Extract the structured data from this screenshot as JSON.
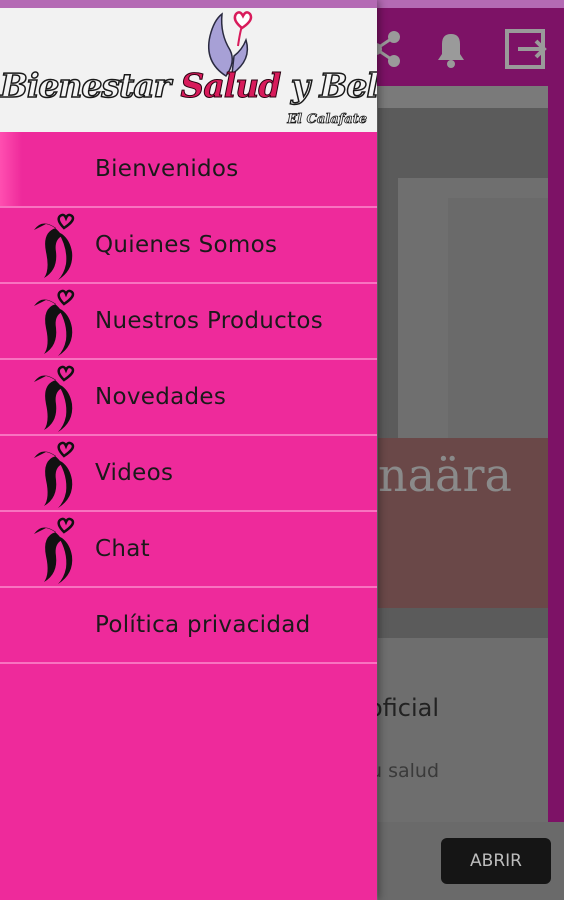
{
  "app": {
    "actions": [
      {
        "icon": "share-icon"
      },
      {
        "icon": "bell-icon"
      },
      {
        "icon": "logout-icon"
      }
    ],
    "card": {
      "brand_text": "naära",
      "title": "oficial",
      "subtitle": "u salud"
    },
    "footer": {
      "button_label": "ABRIR"
    }
  },
  "drawer": {
    "header": {
      "logo_word1": "Bienestar ",
      "logo_word2": "Salud",
      "logo_word3": " y Belleza",
      "logo_sub": "El Calafate"
    },
    "items": [
      {
        "label": "Bienvenidos",
        "icon": "none"
      },
      {
        "label": "Quienes Somos",
        "icon": "brand-heart-icon"
      },
      {
        "label": "Nuestros Productos",
        "icon": "brand-heart-icon"
      },
      {
        "label": "Novedades",
        "icon": "brand-heart-icon"
      },
      {
        "label": "Videos",
        "icon": "brand-heart-icon"
      },
      {
        "label": "Chat",
        "icon": "brand-heart-icon"
      },
      {
        "label": "Política privacidad",
        "icon": "none"
      }
    ]
  },
  "colors": {
    "drawer_bg": "#ee2a9b",
    "appbar_bg": "#7d1266",
    "logo_accent": "#d81b5b"
  }
}
